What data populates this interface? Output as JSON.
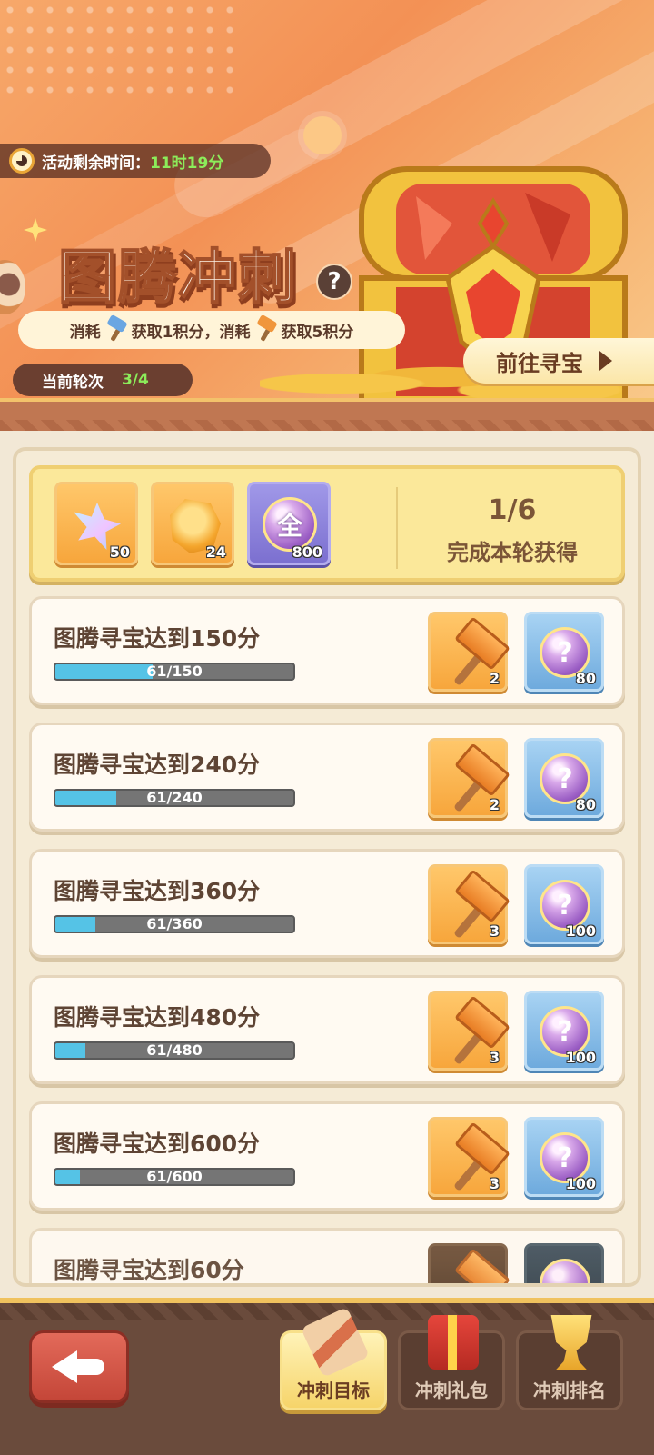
{
  "header": {
    "timer_label": "活动剩余时间：",
    "timer_value": "11时19分",
    "title": "图腾冲刺",
    "help": "?",
    "rule_consume1": "消耗",
    "rule_get1": "获取1积分，消耗",
    "rule_get2": "获取5积分",
    "round_label": "当前轮次",
    "round_value": "3/4",
    "goto_label": "前往寻宝"
  },
  "round_reward": {
    "items": [
      {
        "icon": "crystal-star-icon",
        "count": "50"
      },
      {
        "icon": "amber-stone-icon",
        "count": "24"
      },
      {
        "icon": "all-orb-icon",
        "label": "全",
        "count": "800"
      }
    ],
    "progress": "1/6",
    "caption": "完成本轮获得"
  },
  "tasks": [
    {
      "title": "图腾寻宝达到150分",
      "progress_text": "61/150",
      "current": 61,
      "target": 150,
      "reward1_count": "2",
      "reward2_count": "80"
    },
    {
      "title": "图腾寻宝达到240分",
      "progress_text": "61/240",
      "current": 61,
      "target": 240,
      "reward1_count": "2",
      "reward2_count": "80"
    },
    {
      "title": "图腾寻宝达到360分",
      "progress_text": "61/360",
      "current": 61,
      "target": 360,
      "reward1_count": "3",
      "reward2_count": "100"
    },
    {
      "title": "图腾寻宝达到480分",
      "progress_text": "61/480",
      "current": 61,
      "target": 480,
      "reward1_count": "3",
      "reward2_count": "100"
    },
    {
      "title": "图腾寻宝达到600分",
      "progress_text": "61/600",
      "current": 61,
      "target": 600,
      "reward1_count": "3",
      "reward2_count": "100"
    },
    {
      "title": "图腾寻宝达到60分"
    }
  ],
  "reward_icons": {
    "reward1": "hammer-icon",
    "reward2": "mystery-orb-icon",
    "mystery_label": "?"
  },
  "nav": {
    "tabs": [
      {
        "label": "冲刺目标",
        "icon": "scroll-icon",
        "active": true
      },
      {
        "label": "冲刺礼包",
        "icon": "gift-icon",
        "active": false
      },
      {
        "label": "冲刺排名",
        "icon": "trophy-icon",
        "active": false
      }
    ]
  },
  "colors": {
    "progress_fill": "#55c3e6",
    "timer_value": "#8cec5a",
    "accent": "#f0c25e"
  }
}
